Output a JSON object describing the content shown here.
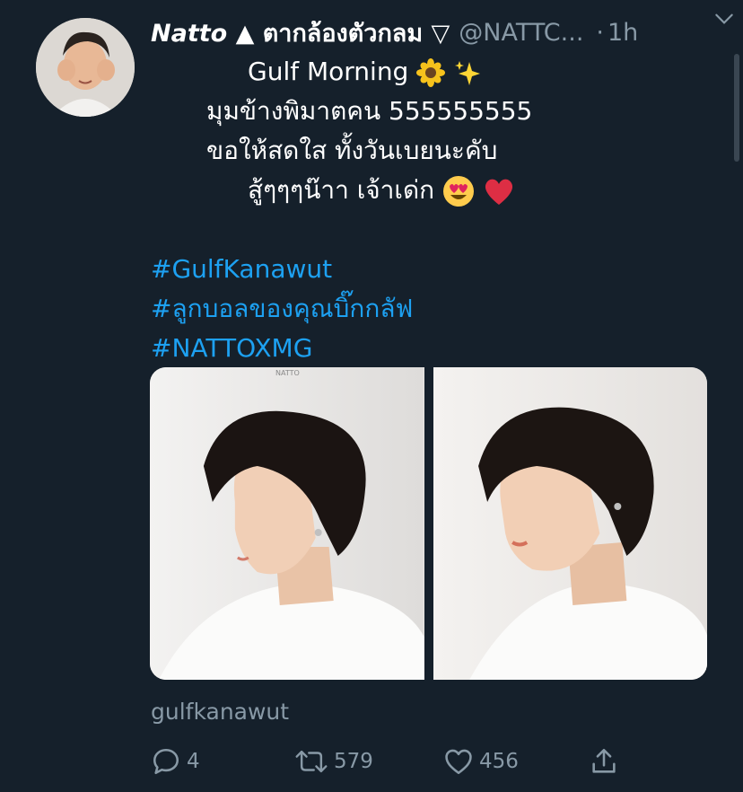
{
  "tweet": {
    "display_name": "Natto",
    "name_suffix": "▲ ตากล้องตัวกลม ▽",
    "handle": "@NATTC...",
    "time_dot": "·",
    "time": "1h",
    "lines": [
      "Gulf Morning",
      "มุมข้างพิมาตคน 555555555",
      "ขอให้สดใส ทั้งวันเบยนะคับ",
      "สู้ๆๆๆน๊าา เจ้าเด่ก"
    ],
    "hashtags": [
      "#GulfKanawut",
      "#ลูกบอลของคุณบิ๊กกลัฟ",
      "#NATTOXMG"
    ],
    "image_caption": "NATTO",
    "credit": "gulfkanawut",
    "counts": {
      "replies": "4",
      "retweets": "579",
      "likes": "456"
    }
  },
  "icons": [
    "avatar",
    "chevron-down-icon",
    "sunflower-icon",
    "sparkles-icon",
    "heart-eyes-icon",
    "red-heart-icon",
    "reply-icon",
    "retweet-icon",
    "like-icon",
    "share-icon"
  ],
  "colors": {
    "background": "#15202b",
    "link": "#1da1f2",
    "muted": "#8899a6",
    "text": "#ffffff"
  }
}
